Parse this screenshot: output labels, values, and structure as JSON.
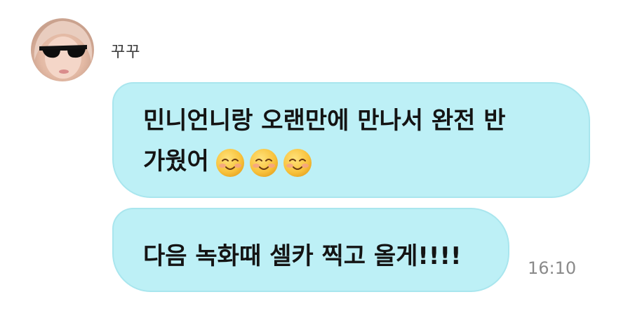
{
  "sender": {
    "name": "꾸꾸"
  },
  "messages": [
    {
      "line1": "민니언니랑 오랜만에 만나서 완전 반",
      "line2": "가웠어",
      "emoji": [
        "smiling-face-icon",
        "smiling-face-icon",
        "smiling-face-icon"
      ]
    },
    {
      "text": "다음 녹화때 셀카 찍고 올게!!!!"
    }
  ],
  "timestamp": "16:10",
  "colors": {
    "bubble": "#bdf0f6",
    "bubble_border": "#a9e6ee",
    "text": "#141414",
    "timestamp": "#8a8a8a"
  }
}
